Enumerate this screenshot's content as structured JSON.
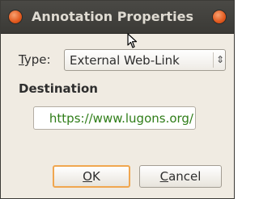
{
  "window": {
    "title": "Annotation Properties"
  },
  "form": {
    "type_label": "Type:",
    "type_value": "External Web-Link",
    "destination_heading": "Destination",
    "destination_value": "https://www.lugons.org/"
  },
  "buttons": {
    "ok": "OK",
    "cancel": "Cancel"
  },
  "colors": {
    "titlebar": "#3b3a36",
    "dialog_background": "#f0ebe2",
    "destination_text": "#2f7d18",
    "default_button_focus": "#f0a64f",
    "window_control": "#e2591e"
  },
  "icons": {
    "close": "close-icon",
    "maximize": "maximize-icon",
    "select_arrow": "chevron-updown-icon",
    "cursor": "mouse-pointer-icon"
  }
}
